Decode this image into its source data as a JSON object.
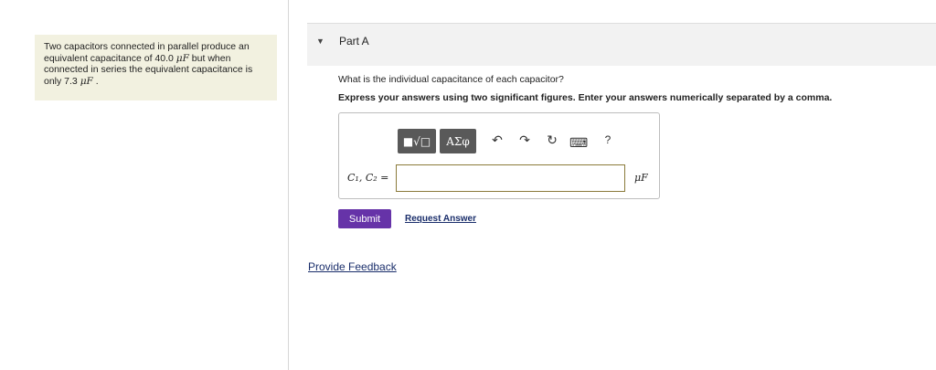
{
  "problem": {
    "line1": "Two capacitors connected in parallel produce an",
    "line2_pre": "equivalent capacitance of 40.0 ",
    "line2_unit": "μF",
    "line2_post": " but when",
    "line3": "connected in series the equivalent capacitance is",
    "line4_pre": "only 7.3 ",
    "line4_unit": "μF",
    "line4_post": " ."
  },
  "part": {
    "caret": "▼",
    "title": "Part A"
  },
  "question": "What is the individual capacitance of each capacitor?",
  "instructions": "Express your answers using two significant figures. Enter your answers numerically separated by a comma.",
  "toolbar": {
    "template_label": "■√□",
    "greek_label": "ΑΣφ",
    "undo_icon": "↶",
    "redo_icon": "↷",
    "reset_icon": "↻",
    "keyboard_icon": "⌨",
    "help_label": "?"
  },
  "answer": {
    "variable_label": "C₁, C₂ =",
    "value": "",
    "unit": "μF"
  },
  "actions": {
    "submit_label": "Submit",
    "request_answer_label": "Request Answer",
    "feedback_label": "Provide Feedback"
  },
  "colors": {
    "submit_bg": "#6633a8",
    "problem_bg": "#f2f1e0",
    "link": "#1a2e6b"
  }
}
